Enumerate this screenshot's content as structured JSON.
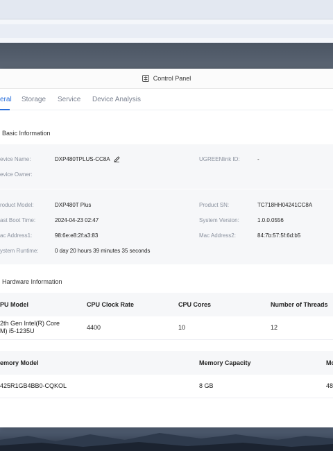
{
  "window": {
    "title": "Control Panel",
    "icon": "control-panel-icon"
  },
  "tabs": [
    {
      "label": "eral",
      "active": true
    },
    {
      "label": "Storage",
      "active": false
    },
    {
      "label": "Service",
      "active": false
    },
    {
      "label": "Device Analysis",
      "active": false
    }
  ],
  "basic_info": {
    "title": "Basic Information",
    "device_name_label": "evice Name:",
    "device_name": "DXP480TPLUS-CC8A",
    "ugreenlink_label": "UGREENlink ID:",
    "ugreenlink_value": "-",
    "device_owner_label": "evice Owner:",
    "product_model_label": "roduct Model:",
    "product_model": "DXP480T Plus",
    "product_sn_label": "Product SN:",
    "product_sn": "TC718HH04241CC8A",
    "last_boot_label": "ast Boot Time:",
    "last_boot": "2024-04-23 02:47",
    "system_version_label": "System Version:",
    "system_version": "1.0.0.0556",
    "mac1_label": "ac Address1:",
    "mac1": "98:6e:e8:2f:a3:83",
    "mac2_label": "Mac Address2:",
    "mac2": "84:7b:57:5f:6d:b5",
    "runtime_label": "ystem Runtime:",
    "runtime": "0 day 20 hours 39 minutes 35 seconds"
  },
  "hardware_info": {
    "title": "Hardware Information",
    "cpu_headers": [
      "PU Model",
      "CPU Clock Rate",
      "CPU Cores",
      "Number of Threads"
    ],
    "cpu_row": [
      "2th Gen Intel(R) Core\nM) i5-1235U",
      "4400",
      "10",
      "12"
    ],
    "mem_headers": [
      "emory Model",
      "Memory Capacity",
      "Mo"
    ],
    "mem_row": [
      "425R1GB4BB0-CQKOL",
      "8 GB",
      "48"
    ]
  }
}
